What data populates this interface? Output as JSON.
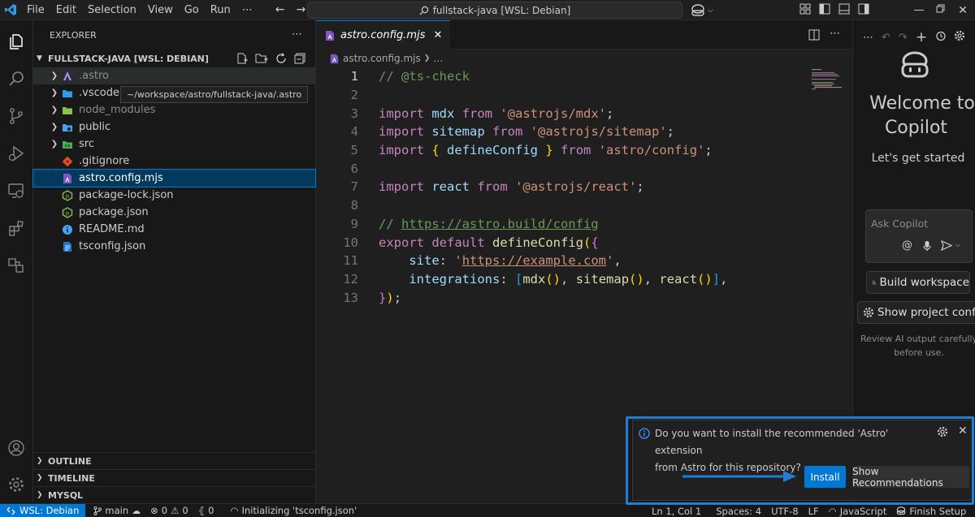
{
  "menu": [
    "File",
    "Edit",
    "Selection",
    "View",
    "Go",
    "Run",
    "⋯"
  ],
  "command_center": {
    "title": "fullstack-java [WSL: Debian]"
  },
  "explorer": {
    "header": "EXPLORER",
    "root": "FULLSTACK-JAVA [WSL: DEBIAN]",
    "items": [
      {
        "name": ".astro",
        "type": "folder"
      },
      {
        "name": ".vscode",
        "type": "folder"
      },
      {
        "name": "node_modules",
        "type": "folder"
      },
      {
        "name": "public",
        "type": "folder"
      },
      {
        "name": "src",
        "type": "folder"
      },
      {
        "name": ".gitignore",
        "type": "file"
      },
      {
        "name": "astro.config.mjs",
        "type": "file"
      },
      {
        "name": "package-lock.json",
        "type": "file"
      },
      {
        "name": "package.json",
        "type": "file"
      },
      {
        "name": "README.md",
        "type": "file"
      },
      {
        "name": "tsconfig.json",
        "type": "file"
      }
    ],
    "tooltip": "~/workspace/astro/fullstack-java/.astro",
    "sections": [
      "OUTLINE",
      "TIMELINE",
      "MYSQL"
    ]
  },
  "editor": {
    "tab": "astro.config.mjs",
    "breadcrumb": [
      "astro.config.mjs",
      "…"
    ],
    "line_numbers": [
      "1",
      "2",
      "3",
      "4",
      "5",
      "6",
      "7",
      "8",
      "9",
      "10",
      "11",
      "12",
      "13"
    ]
  },
  "copilot": {
    "welcome_line1": "Welcome to",
    "welcome_line2": "Copilot",
    "subtitle": "Let's get started",
    "ask_placeholder": "Ask Copilot",
    "build_workspace": "Build workspace",
    "show_project_config": "Show project config",
    "note_line1": "Review AI output carefully",
    "note_line2": "before use."
  },
  "notification": {
    "line1": "Do you want to install the recommended 'Astro' extension",
    "line2": "from Astro for this repository?",
    "install": "Install",
    "show_recommendations": "Show Recommendations"
  },
  "statusbar": {
    "remote": "WSL: Debian",
    "branch": "main",
    "errors": "0",
    "warnings": "0",
    "ports": "0",
    "task": "Initializing 'tsconfig.json'",
    "position": "Ln 1, Col 1",
    "spaces": "Spaces: 4",
    "encoding": "UTF-8",
    "eol": "LF",
    "language": "JavaScript",
    "finish_setup": "Finish Setup"
  },
  "colors": {
    "accent": "#0078d4",
    "highlight_outline": "#1f7fd4"
  }
}
